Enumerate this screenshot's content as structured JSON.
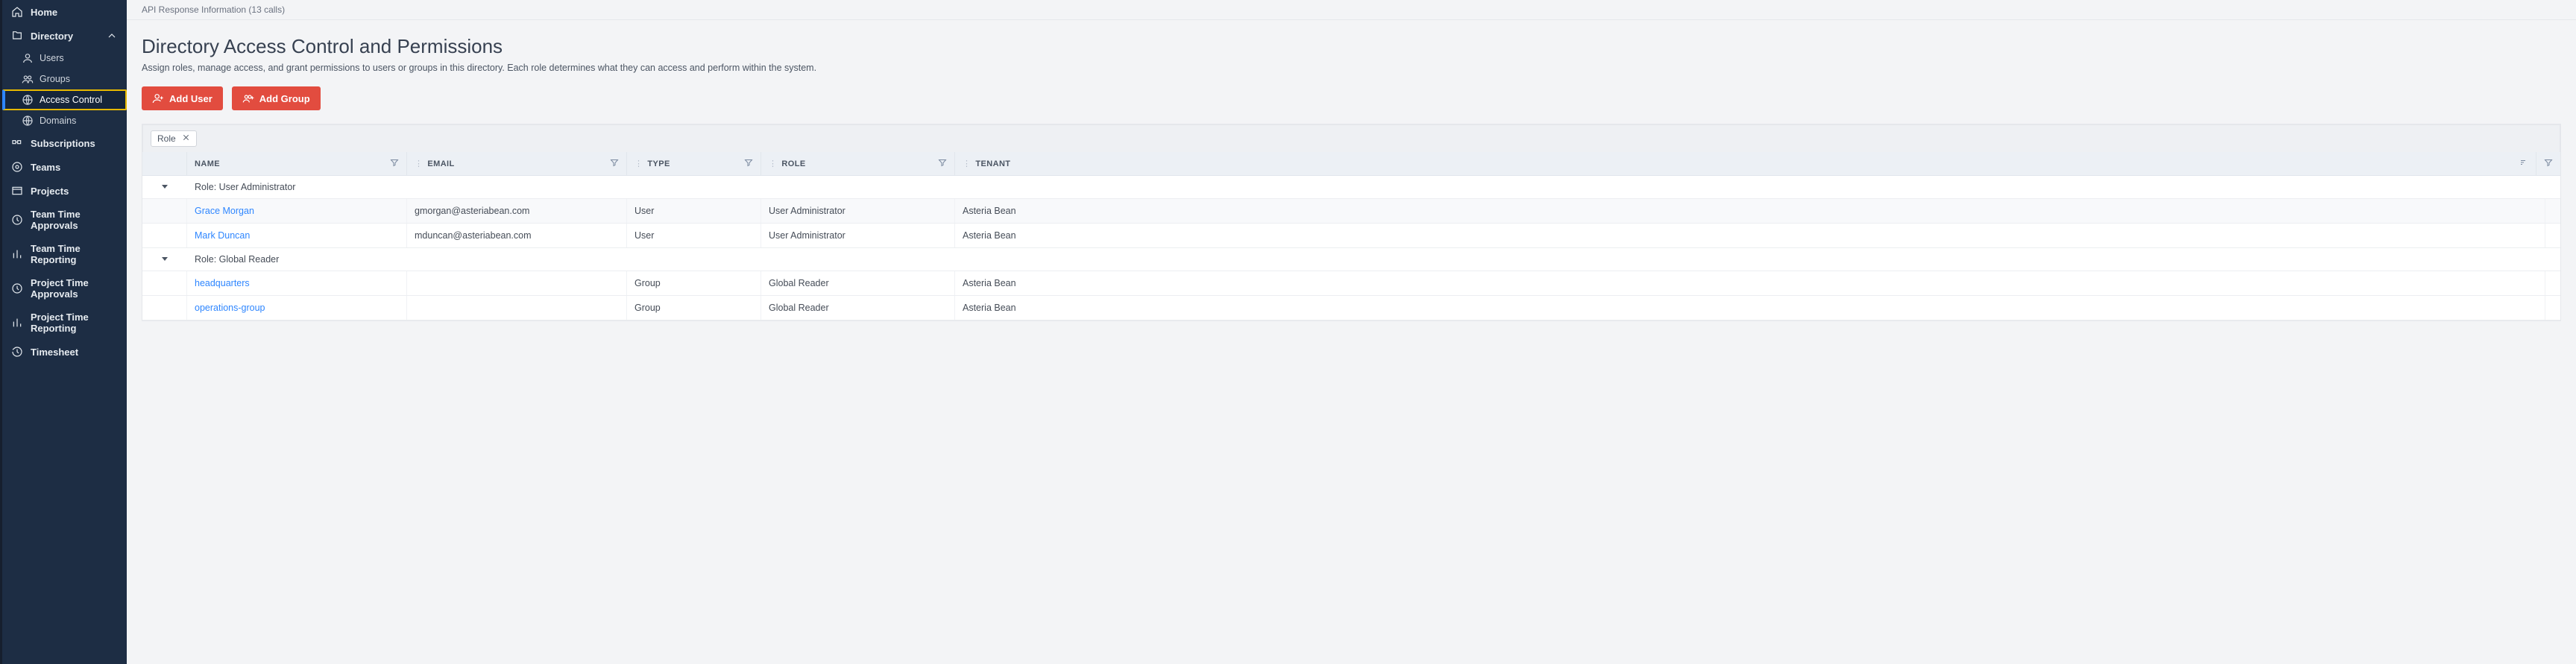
{
  "sidebar": {
    "home": "Home",
    "directory": "Directory",
    "directory_children": {
      "users": "Users",
      "groups": "Groups",
      "access_control": "Access Control",
      "domains": "Domains"
    },
    "subscriptions": "Subscriptions",
    "teams": "Teams",
    "projects": "Projects",
    "team_time_approvals": "Team Time Approvals",
    "team_time_reporting": "Team Time Reporting",
    "project_time_approvals": "Project Time Approvals",
    "project_time_reporting": "Project Time Reporting",
    "timesheet": "Timesheet"
  },
  "api_bar": "API Response Information (13 calls)",
  "page": {
    "title": "Directory Access Control and Permissions",
    "description": "Assign roles, manage access, and grant permissions to users or groups in this directory. Each role determines what they can access and perform within the system."
  },
  "buttons": {
    "add_user": "Add User",
    "add_group": "Add Group"
  },
  "filter_chip": {
    "label": "Role"
  },
  "columns": {
    "name": "NAME",
    "email": "EMAIL",
    "type": "TYPE",
    "role": "ROLE",
    "tenant": "TENANT"
  },
  "groups": [
    {
      "header": "Role: User Administrator",
      "rows": [
        {
          "name": "Grace Morgan",
          "email": "gmorgan@asteriabean.com",
          "type": "User",
          "role": "User Administrator",
          "tenant": "Asteria Bean"
        },
        {
          "name": "Mark Duncan",
          "email": "mduncan@asteriabean.com",
          "type": "User",
          "role": "User Administrator",
          "tenant": "Asteria Bean"
        }
      ]
    },
    {
      "header": "Role: Global Reader",
      "rows": [
        {
          "name": "headquarters",
          "email": "",
          "type": "Group",
          "role": "Global Reader",
          "tenant": "Asteria Bean"
        },
        {
          "name": "operations-group",
          "email": "",
          "type": "Group",
          "role": "Global Reader",
          "tenant": "Asteria Bean"
        }
      ]
    }
  ]
}
